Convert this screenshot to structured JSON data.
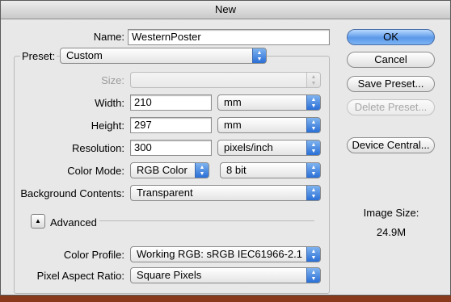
{
  "window": {
    "title": "New"
  },
  "form": {
    "name_label": "Name:",
    "name_value": "WesternPoster",
    "preset_label": "Preset:",
    "preset_value": "Custom",
    "size_label": "Size:",
    "size_value": "",
    "width_label": "Width:",
    "width_value": "210",
    "width_unit": "mm",
    "height_label": "Height:",
    "height_value": "297",
    "height_unit": "mm",
    "resolution_label": "Resolution:",
    "resolution_value": "300",
    "resolution_unit": "pixels/inch",
    "color_mode_label": "Color Mode:",
    "color_mode_value": "RGB Color",
    "bit_depth_value": "8 bit",
    "background_label": "Background Contents:",
    "background_value": "Transparent",
    "advanced_label": "Advanced",
    "color_profile_label": "Color Profile:",
    "color_profile_value": "Working RGB:  sRGB IEC61966-2.1",
    "pixel_aspect_label": "Pixel Aspect Ratio:",
    "pixel_aspect_value": "Square Pixels"
  },
  "buttons": {
    "ok": "OK",
    "cancel": "Cancel",
    "save_preset": "Save Preset...",
    "delete_preset": "Delete Preset...",
    "device_central": "Device Central..."
  },
  "info": {
    "image_size_label": "Image Size:",
    "image_size_value": "24.9M"
  },
  "icons": {
    "popup_arrows": "up-down-arrows-icon",
    "disclosure": "triangle-up-icon"
  },
  "colors": {
    "accent": "#2a6fd6",
    "window_bg": "#e8e8e8"
  }
}
